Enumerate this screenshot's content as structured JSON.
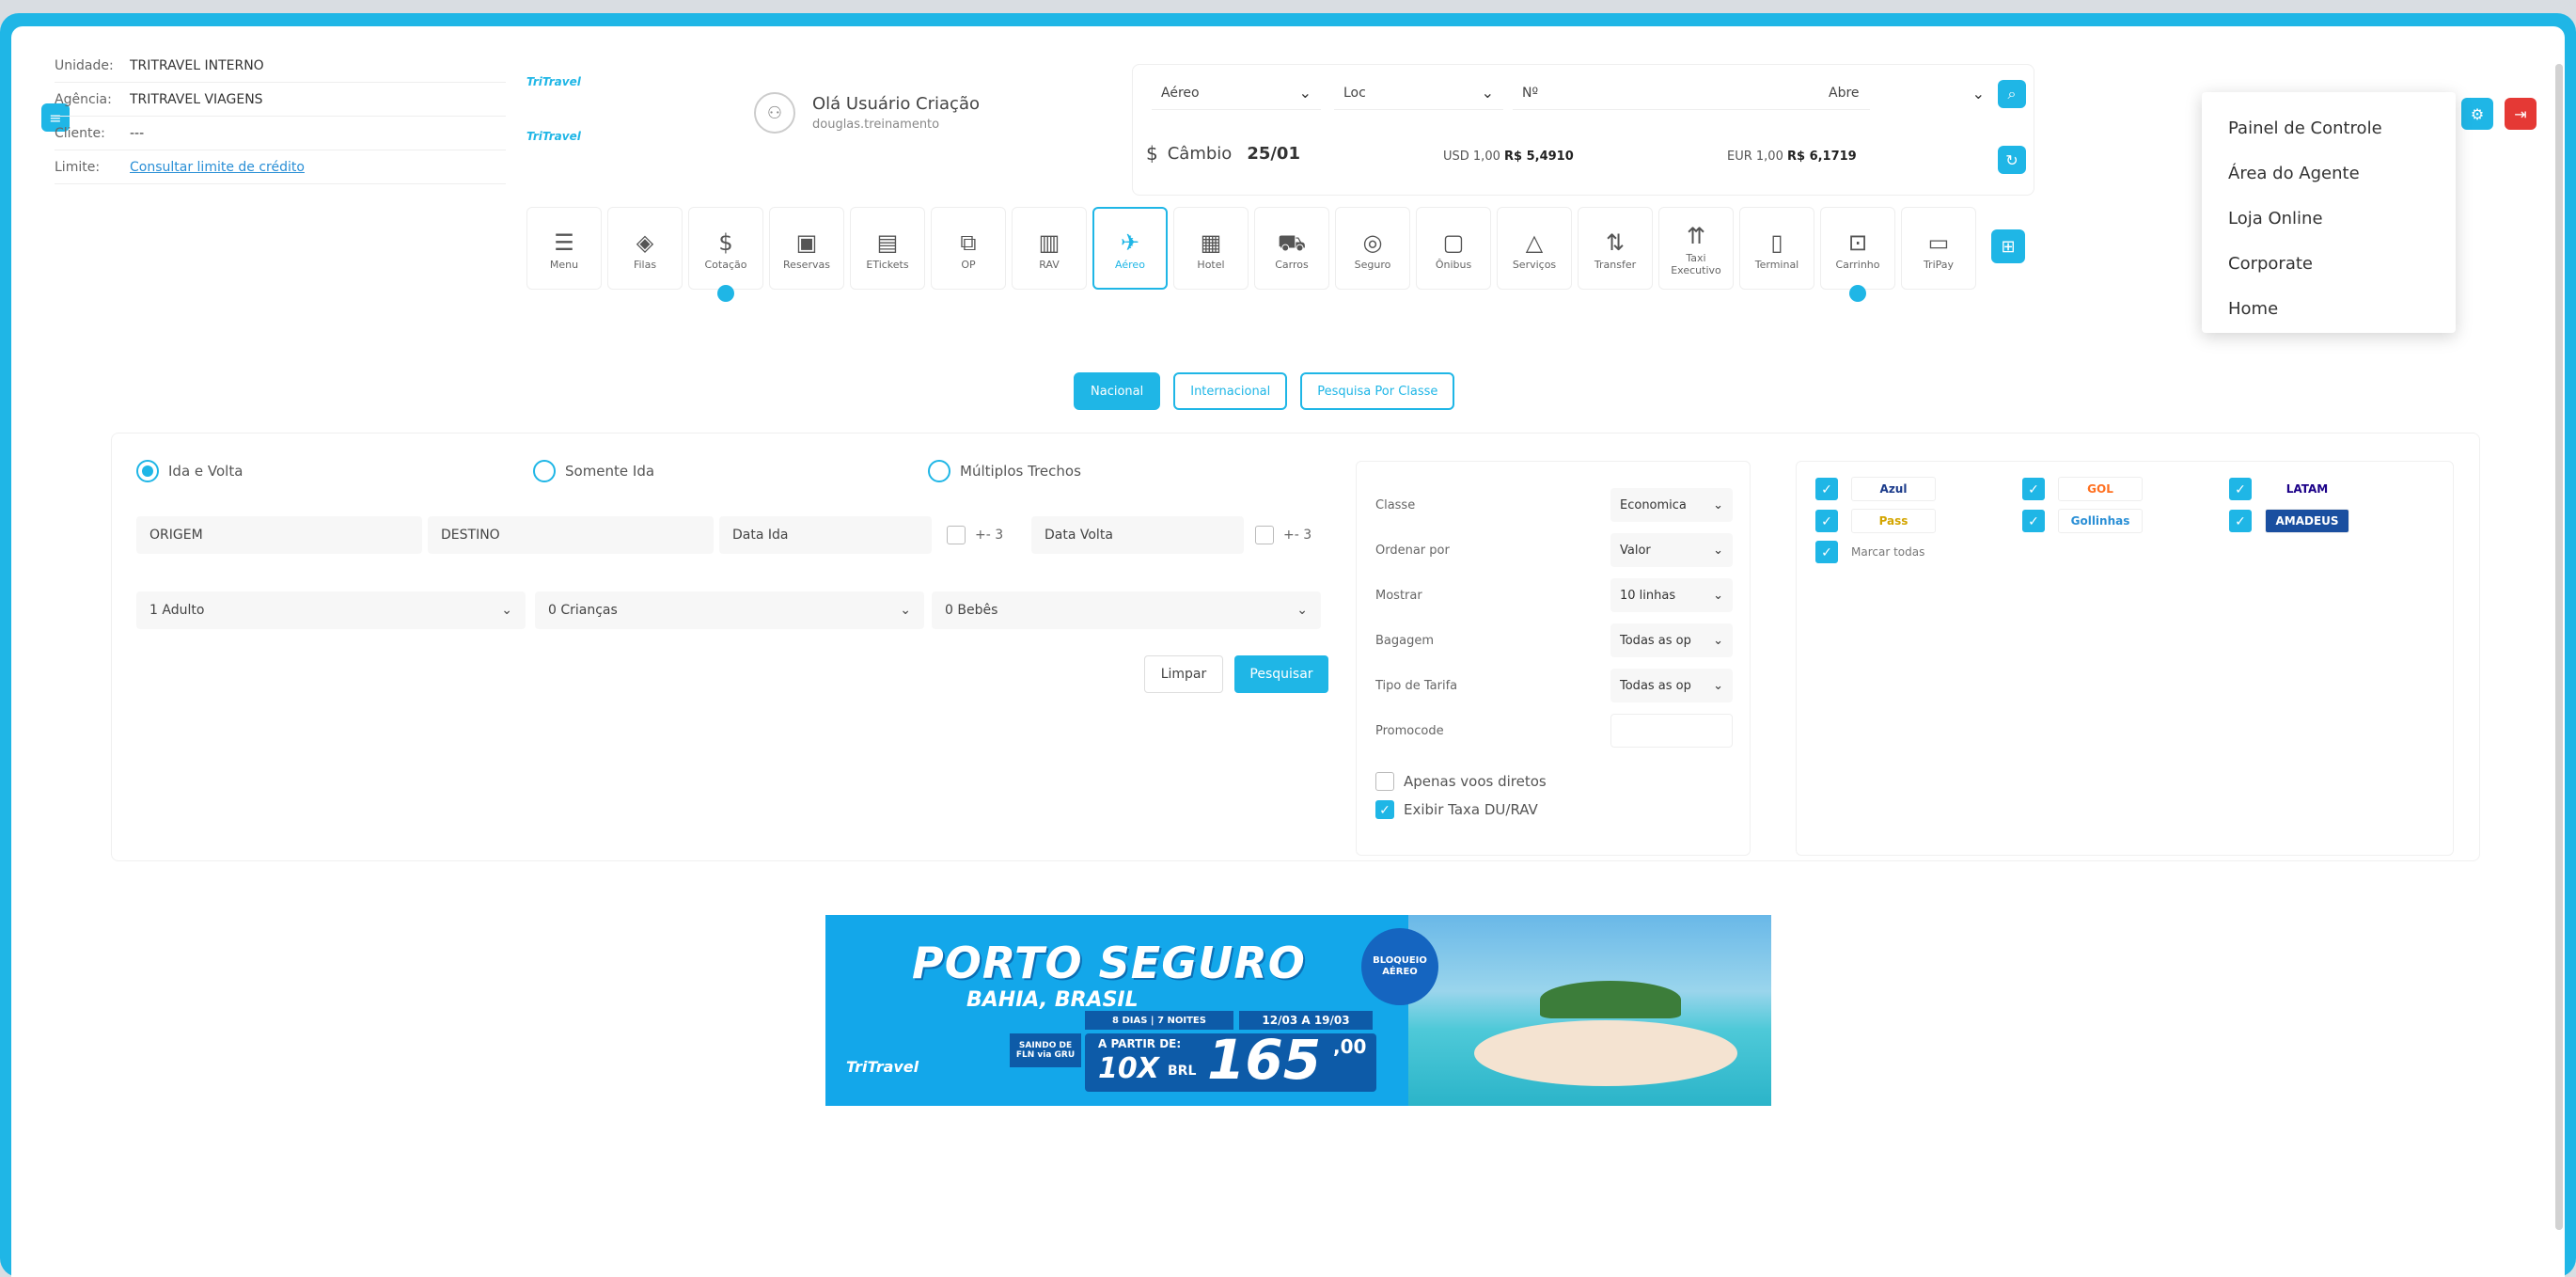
{
  "header": {
    "unidade_label": "Unidade:",
    "unidade_value": "TRITRAVEL INTERNO",
    "agencia_label": "Agência:",
    "agencia_value": "TRITRAVEL VIAGENS",
    "cliente_label": "Cliente:",
    "cliente_value": "---",
    "limite_label": "Limite:",
    "limite_link": "Consultar limite de crédito",
    "user_greeting": "Olá Usuário Criação",
    "user_login": "douglas.treinamento"
  },
  "filters": {
    "type": "Aéreo",
    "loc": "Loc",
    "numero": "Nº",
    "status": "Abre",
    "cambio_label": "Câmbio",
    "cambio_date": "25/01",
    "usd_label": "USD 1,00",
    "usd_value": "R$ 5,4910",
    "eur_label": "EUR 1,00",
    "eur_value": "R$ 6,1719"
  },
  "menu": {
    "items": [
      "Painel de Controle",
      "Área do Agente",
      "Loja Online",
      "Corporate",
      "Home"
    ]
  },
  "toolbar": {
    "items": [
      {
        "label": "Menu",
        "icon": "menu-icon",
        "glyph": "☰"
      },
      {
        "label": "Filas",
        "icon": "layers-icon",
        "glyph": "◈"
      },
      {
        "label": "Cotação",
        "icon": "dollar-icon",
        "glyph": "$"
      },
      {
        "label": "Reservas",
        "icon": "calendar-icon",
        "glyph": "▣"
      },
      {
        "label": "ETickets",
        "icon": "ticket-icon",
        "glyph": "▤"
      },
      {
        "label": "OP",
        "icon": "op-icon",
        "glyph": "⧉"
      },
      {
        "label": "RAV",
        "icon": "rav-icon",
        "glyph": "▥"
      },
      {
        "label": "Aéreo",
        "icon": "plane-icon",
        "glyph": "✈"
      },
      {
        "label": "Hotel",
        "icon": "hotel-icon",
        "glyph": "▦"
      },
      {
        "label": "Carros",
        "icon": "car-icon",
        "glyph": "⛟"
      },
      {
        "label": "Seguro",
        "icon": "shield-icon",
        "glyph": "◎"
      },
      {
        "label": "Ônibus",
        "icon": "bus-icon",
        "glyph": "▢"
      },
      {
        "label": "Serviços",
        "icon": "bell-icon",
        "glyph": "△"
      },
      {
        "label": "Transfer",
        "icon": "transfer-icon",
        "glyph": "⇅"
      },
      {
        "label": "Taxi Executivo",
        "icon": "taxi-icon",
        "glyph": "⇈"
      },
      {
        "label": "Terminal",
        "icon": "terminal-icon",
        "glyph": "▯"
      },
      {
        "label": "Carrinho",
        "icon": "cart-icon",
        "glyph": "⊡"
      },
      {
        "label": "TriPay",
        "icon": "wallet-icon",
        "glyph": "▭"
      }
    ]
  },
  "tabs": [
    "Nacional",
    "Internacional",
    "Pesquisa Por Classe"
  ],
  "search": {
    "trip_types": [
      "Ida e Volta",
      "Somente Ida",
      "Múltiplos Trechos"
    ],
    "origem": "ORIGEM",
    "destino": "DESTINO",
    "data_ida": "Data Ida",
    "data_volta": "Data Volta",
    "flex": "+- 3",
    "adultos": "1 Adulto",
    "criancas": "0 Crianças",
    "bebes": "0 Bebês",
    "limpar": "Limpar",
    "pesquisar": "Pesquisar"
  },
  "options": {
    "classe_label": "Classe",
    "classe_value": "Economica",
    "ordenar_label": "Ordenar por",
    "ordenar_value": "Valor",
    "mostrar_label": "Mostrar",
    "mostrar_value": "10 linhas",
    "bagagem_label": "Bagagem",
    "bagagem_value": "Todas as op",
    "tarifa_label": "Tipo de Tarifa",
    "tarifa_value": "Todas as op",
    "promocode_label": "Promocode",
    "apenas_diretos": "Apenas voos diretos",
    "exibir_taxa": "Exibir Taxa DU/RAV"
  },
  "airlines": {
    "azul": "Azul",
    "gol": "GOL",
    "latam": "LATAM",
    "voepass": "Pass",
    "gollinhas": "Gollinhas",
    "amadeus": "AMADEUS",
    "marcar_todas": "Marcar todas"
  },
  "banner": {
    "title": "PORTO SEGURO",
    "subtitle": "BAHIA, BRASIL",
    "circle": "BLOQUEIO AÉREO",
    "dias": "8 DIAS | 7 NOITES",
    "datas": "12/03 A 19/03",
    "partida": "SAINDO DE FLN via GRU",
    "a_partir": "A PARTIR DE:",
    "parcelas": "10X",
    "moeda": "BRL",
    "valor": "165",
    "centavos": ",00",
    "logo": "TriTravel"
  },
  "colors": {
    "accent": "#1fb6e6",
    "logout": "#e53935"
  }
}
